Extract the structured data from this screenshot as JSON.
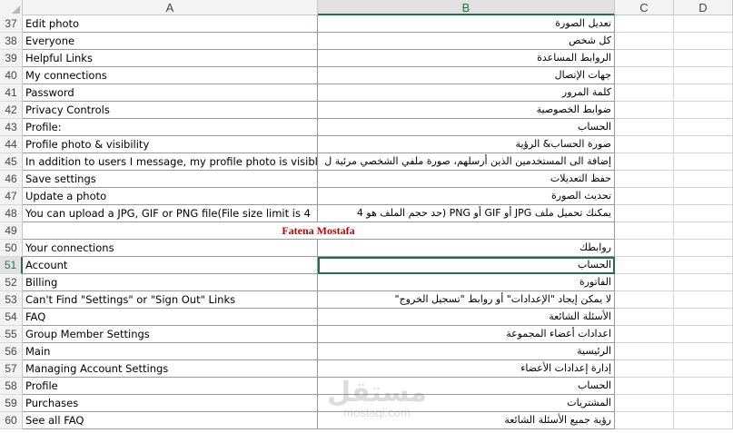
{
  "columns": [
    "A",
    "B",
    "C",
    "D"
  ],
  "selected_column": "B",
  "selected_row": "51",
  "rows": [
    {
      "num": "37",
      "a": "Edit photo",
      "b": "تعديل الصورة"
    },
    {
      "num": "38",
      "a": "Everyone",
      "b": "كل شخص"
    },
    {
      "num": "39",
      "a": "Helpful Links",
      "b": "الروابط المساعدة"
    },
    {
      "num": "40",
      "a": "My connections",
      "b": "جهات الإتصال"
    },
    {
      "num": "41",
      "a": "Password",
      "b": "كلمة المرور"
    },
    {
      "num": "42",
      "a": "Privacy Controls",
      "b": "ضوابط الخصوصية"
    },
    {
      "num": "43",
      "a": "Profile:",
      "b": "الحساب"
    },
    {
      "num": "44",
      "a": "Profile photo & visibility",
      "b": "صورة الحساب& الرؤية"
    },
    {
      "num": "45",
      "a": "In addition to users I message, my profile photo is visible",
      "b": "إضافة الى المستخدمين الذين أرسلهم، صورة ملفي الشخصي مرئية ل"
    },
    {
      "num": "46",
      "a": "Save settings",
      "b": "حفظ التعديلات"
    },
    {
      "num": "47",
      "a": "Update a photo",
      "b": "تحديث الصورة"
    },
    {
      "num": "48",
      "a": "You can upload a JPG, GIF or PNG file(File size limit is 4",
      "b": "يمكنك تحميل ملف JPG أو GIF أو PNG (حد حجم الملف هو 4"
    },
    {
      "num": "49",
      "merged": "Fatena Mostafa"
    },
    {
      "num": "50",
      "a": "Your connections",
      "b": "روابطك"
    },
    {
      "num": "51",
      "a": "Account",
      "b": "الحساب"
    },
    {
      "num": "52",
      "a": "Billing",
      "b": "الفاتورة"
    },
    {
      "num": "53",
      "a": "Can't Find \"Settings\" or \"Sign Out\" Links",
      "b": "لا يمكن إيجاد \"الإعدادات\" أو روابط \"تسجيل الخروج\""
    },
    {
      "num": "54",
      "a": "FAQ",
      "b": "الأسئلة الشائعة"
    },
    {
      "num": "55",
      "a": "Group Member Settings",
      "b": "اعدادات أعضاء المجموعة"
    },
    {
      "num": "56",
      "a": "Main",
      "b": "الرئيسية"
    },
    {
      "num": "57",
      "a": "Managing Account Settings",
      "b": "إدارة إعدادات الأعضاء"
    },
    {
      "num": "58",
      "a": "Profile",
      "b": "الحساب"
    },
    {
      "num": "59",
      "a": "Purchases",
      "b": "المشتريات"
    },
    {
      "num": "60",
      "a": "See all FAQ",
      "b": "رؤية جميع الأسئلة الشائعة"
    }
  ],
  "watermark": {
    "arabic": "مستقل",
    "latin": "mostaql.com"
  }
}
